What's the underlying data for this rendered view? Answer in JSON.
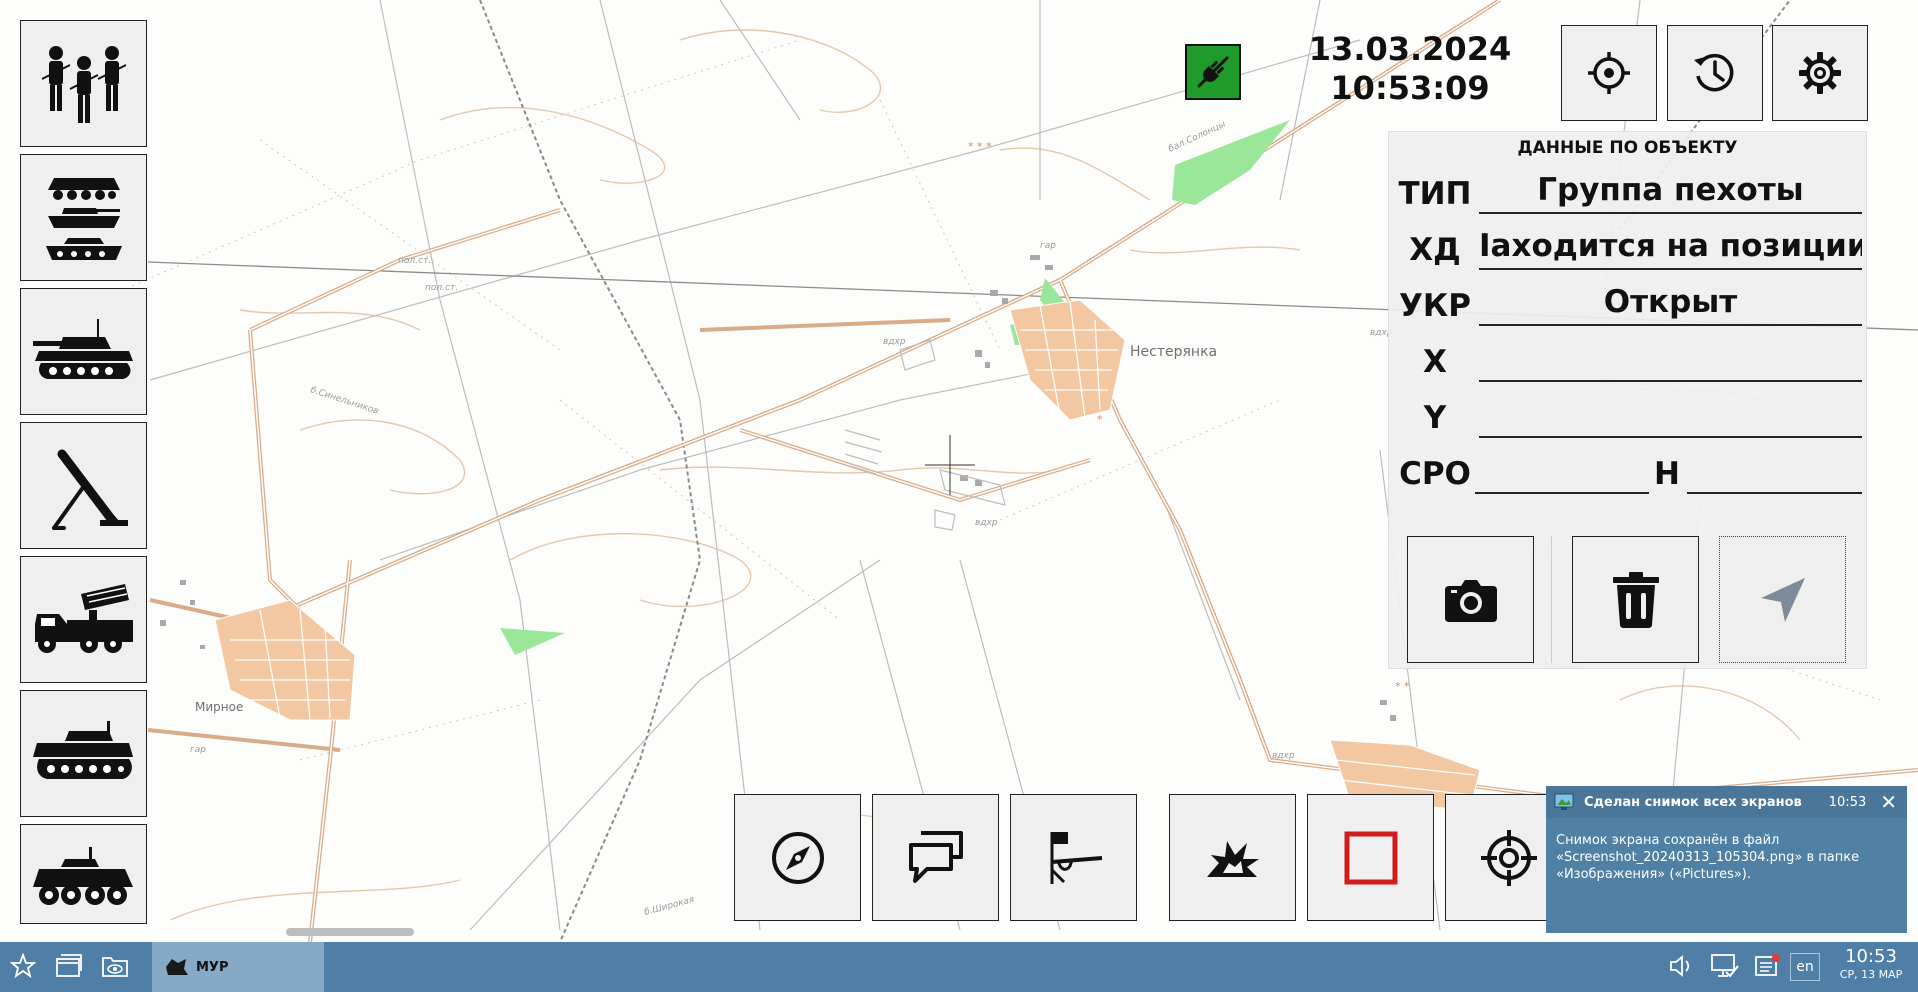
{
  "header": {
    "date": "13.03.2024",
    "time": "10:53:09",
    "connection_icon": "unplugged-icon",
    "connection_color": "#1e9b2a"
  },
  "top_buttons": [
    {
      "name": "locate-button",
      "icon": "crosshair-locate-icon"
    },
    {
      "name": "history-button",
      "icon": "history-clock-icon"
    },
    {
      "name": "settings-button",
      "icon": "gear-icon"
    }
  ],
  "sidebar": {
    "items": [
      {
        "label": "infantry",
        "icon": "infantry-group-icon"
      },
      {
        "label": "armored-column",
        "icon": "armored-column-icon"
      },
      {
        "label": "tank",
        "icon": "tank-icon"
      },
      {
        "label": "mortar",
        "icon": "mortar-icon"
      },
      {
        "label": "rocket-launcher",
        "icon": "mlrs-truck-icon"
      },
      {
        "label": "ifv",
        "icon": "ifv-icon"
      },
      {
        "label": "apc",
        "icon": "apc-icon"
      }
    ]
  },
  "map": {
    "labels": {
      "town1": "Нестерянка",
      "town2": "Мирное"
    }
  },
  "object_panel": {
    "title": "ДАННЫЕ ПО ОБЪЕКТУ",
    "type_label": "ТИП",
    "type_value": "Группа пехоты",
    "hd_label": "ХД",
    "hd_value": "Iаходится на позиции",
    "ukr_label": "УКР",
    "ukr_value": "Открыт",
    "x_label": "X",
    "x_value": "",
    "y_label": "Y",
    "y_value": "",
    "sro_label": "СРО",
    "sro_value": "",
    "h_label": "Н",
    "h_value": "",
    "buttons": [
      {
        "name": "photo-button",
        "icon": "camera-icon"
      },
      {
        "name": "delete-button",
        "icon": "trash-icon"
      },
      {
        "name": "send-button",
        "icon": "send-arrow-icon"
      }
    ]
  },
  "bottom_toolbar": [
    {
      "name": "compass-button",
      "icon": "compass-icon"
    },
    {
      "name": "messages-button",
      "icon": "chat-bubbles-icon"
    },
    {
      "name": "flag-weapon-button",
      "icon": "flag-weapon-icon"
    },
    {
      "name": "explosion-button",
      "icon": "explosion-icon"
    },
    {
      "name": "stop-button",
      "icon": "red-square-icon",
      "color": "#d01c1c"
    },
    {
      "name": "target-button",
      "icon": "target-icon"
    }
  ],
  "notification": {
    "title": "Сделан снимок всех экранов",
    "time": "10:53",
    "line1": "Снимок экрана сохранён в файл",
    "line2": "«Screenshot_20240313_105304.png» в папке",
    "line3": "«Изображения» («Pictures»)."
  },
  "taskbar": {
    "app_label": "МУР",
    "lang": "en",
    "clock_time": "10:53",
    "clock_date": "СР, 13 МАР"
  }
}
